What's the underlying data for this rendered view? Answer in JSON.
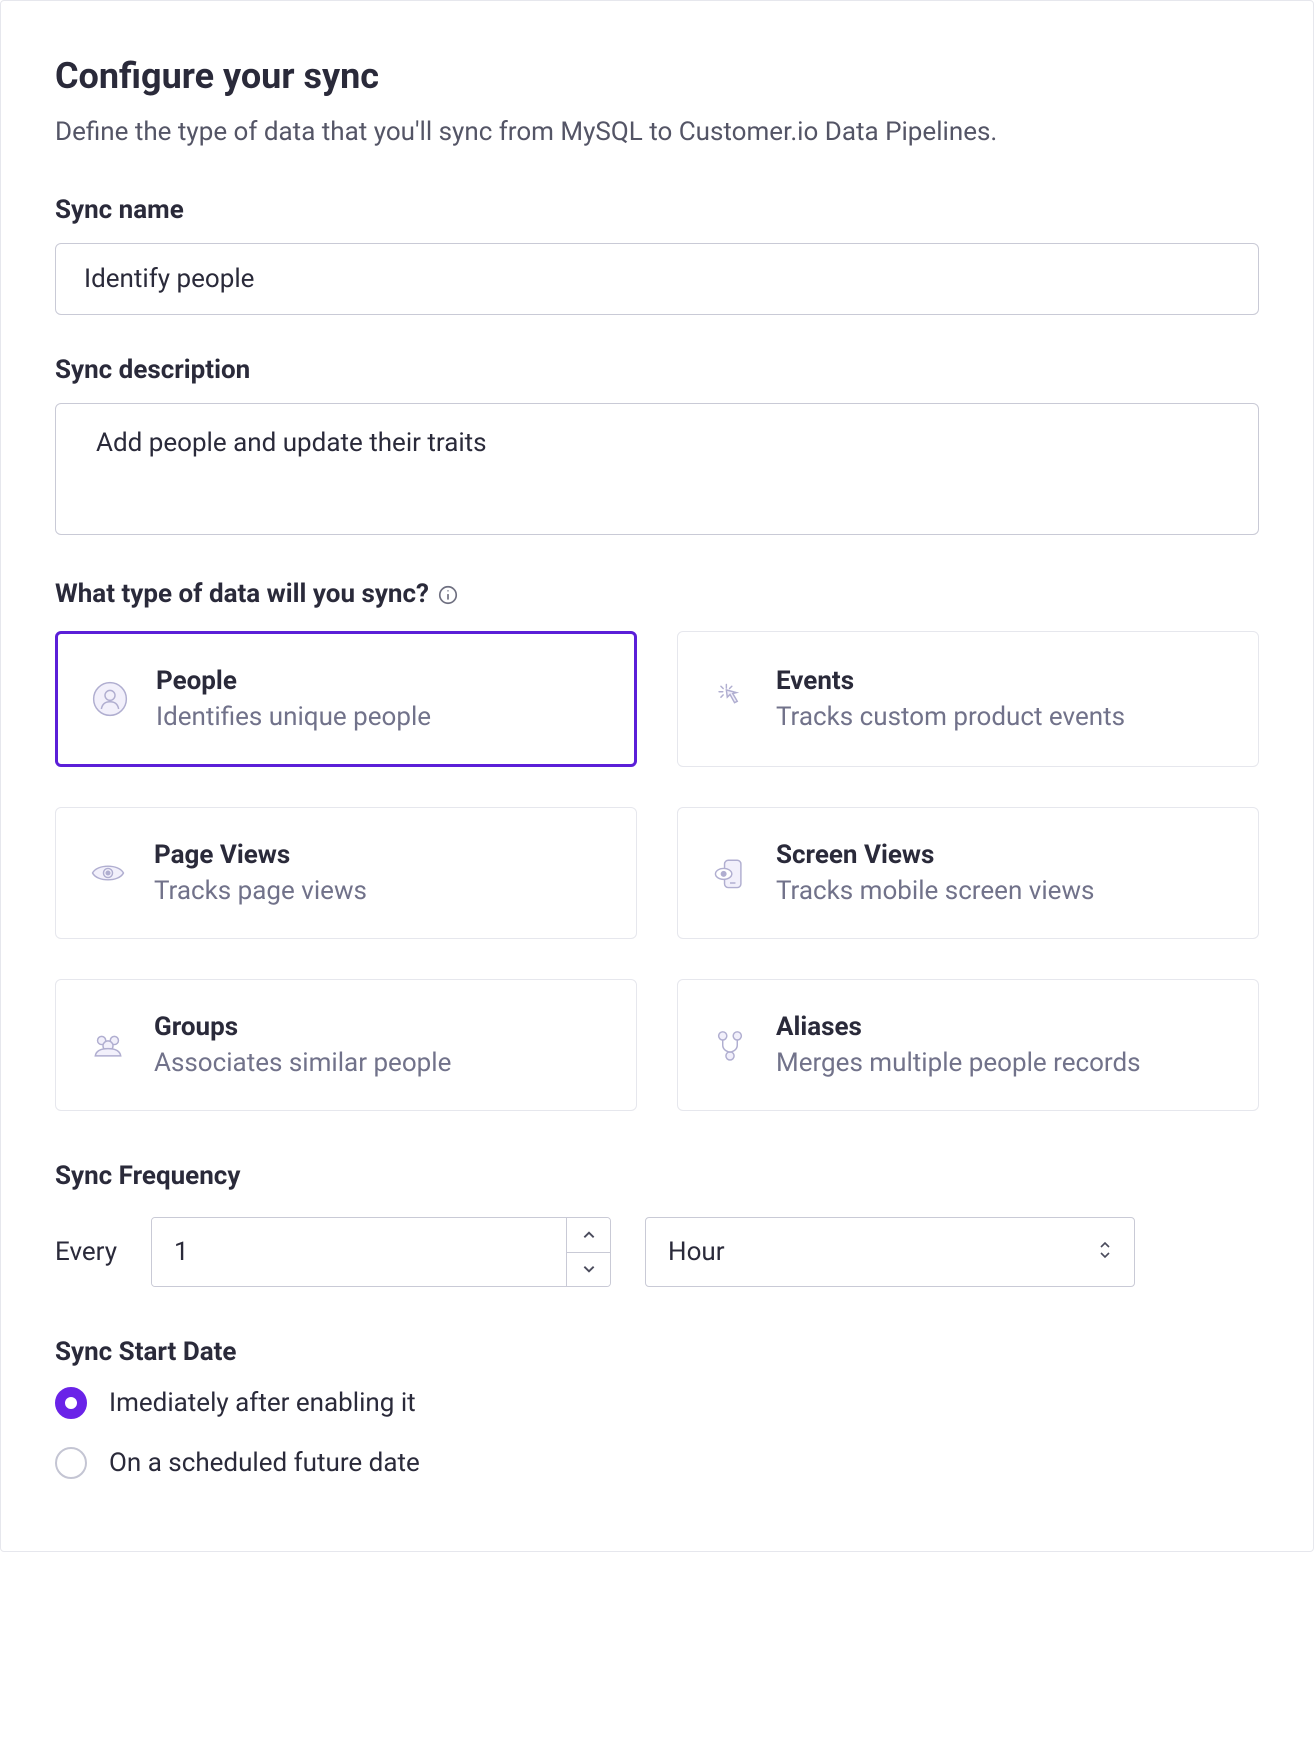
{
  "header": {
    "title": "Configure your sync",
    "subtitle": "Define the type of data that you'll sync from MySQL to Customer.io Data Pipelines."
  },
  "sync_name": {
    "label": "Sync name",
    "value": "Identify people"
  },
  "sync_description": {
    "label": "Sync description",
    "value": "Add people and update their traits"
  },
  "data_type_heading": "What type of data will you sync?",
  "data_types": [
    {
      "title": "People",
      "desc": "Identifies unique people",
      "selected": true
    },
    {
      "title": "Events",
      "desc": "Tracks custom product events",
      "selected": false
    },
    {
      "title": "Page Views",
      "desc": "Tracks page views",
      "selected": false
    },
    {
      "title": "Screen Views",
      "desc": "Tracks mobile screen views",
      "selected": false
    },
    {
      "title": "Groups",
      "desc": "Associates similar people",
      "selected": false
    },
    {
      "title": "Aliases",
      "desc": "Merges multiple people records",
      "selected": false
    }
  ],
  "freq": {
    "heading": "Sync Frequency",
    "every": "Every",
    "interval": "1",
    "unit": "Hour"
  },
  "start": {
    "heading": "Sync Start Date",
    "options": [
      {
        "label": "Imediately after enabling it",
        "selected": true
      },
      {
        "label": "On a scheduled future date",
        "selected": false
      }
    ]
  },
  "colors": {
    "accent": "#5b1fd8",
    "radio": "#6a23e8"
  }
}
